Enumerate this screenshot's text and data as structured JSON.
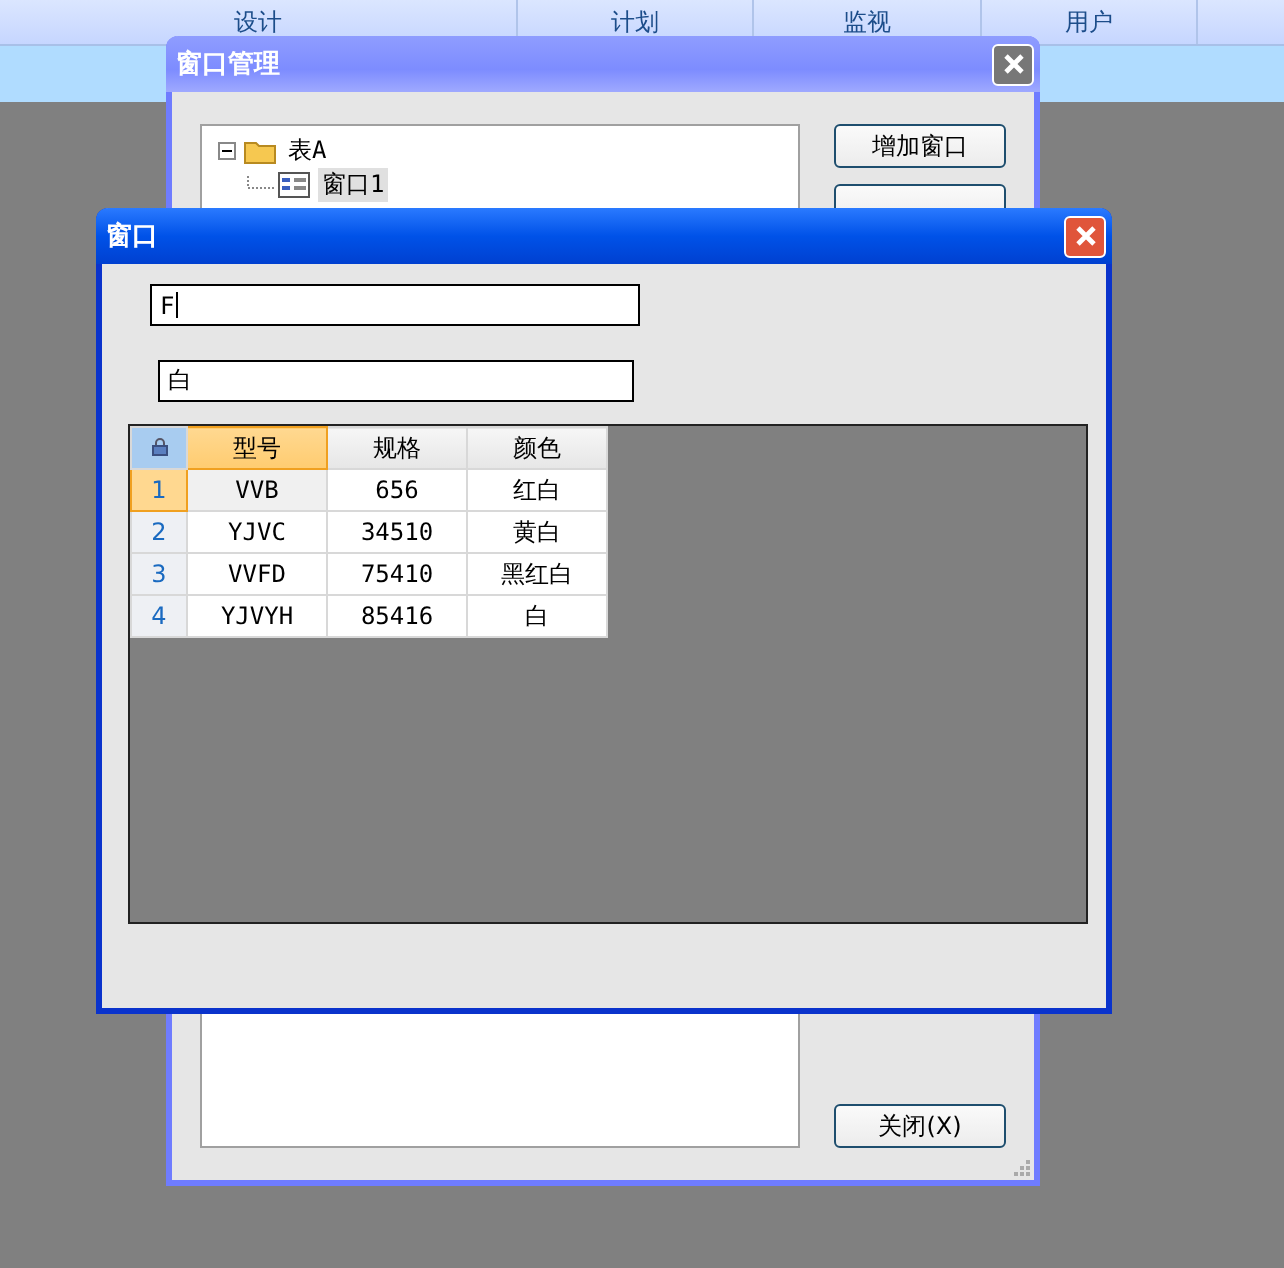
{
  "menu_bar": {
    "items": [
      {
        "label": "设计",
        "selected": false
      },
      {
        "label": "计划",
        "selected": false
      },
      {
        "label": "监视",
        "selected": false
      },
      {
        "label": "用户",
        "selected": false
      }
    ]
  },
  "manager_window": {
    "title": "窗口管理",
    "tree": [
      {
        "label": "表A",
        "kind": "folder",
        "expanded": true,
        "selected": false,
        "children": [
          {
            "label": "窗口1",
            "kind": "form",
            "selected": true
          }
        ]
      }
    ],
    "buttons": [
      {
        "kind": "labeled",
        "label": "增加窗口"
      },
      {
        "kind": "covered"
      }
    ],
    "close_button": "关闭(X)"
  },
  "form_window": {
    "title": "窗口",
    "fields": [
      {
        "value": "F",
        "focused": true
      },
      {
        "value": "白",
        "focused": false
      }
    ],
    "grid": {
      "columns": [
        {
          "label": "型号",
          "selected": true
        },
        {
          "label": "规格",
          "selected": false
        },
        {
          "label": "颜色",
          "selected": false
        }
      ],
      "rows": [
        {
          "number": "1",
          "selected": true,
          "cells": [
            "VVB",
            "656",
            "红白"
          ]
        },
        {
          "number": "2",
          "selected": false,
          "cells": [
            "YJVC",
            "34510",
            "黄白"
          ]
        },
        {
          "number": "3",
          "selected": false,
          "cells": [
            "VVFD",
            "75410",
            "黑红白"
          ]
        },
        {
          "number": "4",
          "selected": false,
          "cells": [
            "YJVYH",
            "85416",
            "白"
          ]
        }
      ]
    }
  }
}
